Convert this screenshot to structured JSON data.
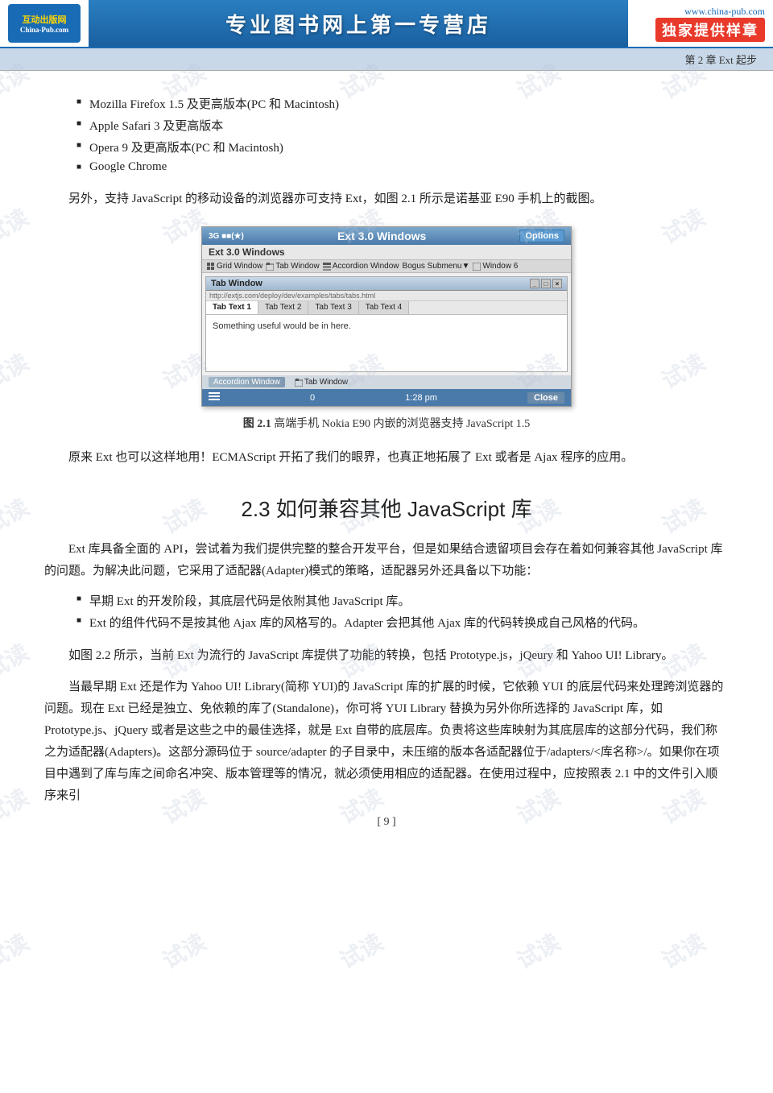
{
  "header": {
    "logo_top": "互动出版网",
    "logo_bottom": "China-Pub.com",
    "title": "专业图书网上第一专营店",
    "website": "www.china-pub.com",
    "exclusive": "独家提供样章"
  },
  "chapter_bar": {
    "text": "第 2 章   Ext 起步"
  },
  "bullet_items": [
    "Mozilla Firefox 1.5 及更高版本(PC 和 Macintosh)",
    "Apple Safari 3 及更高版本",
    "Opera 9 及更高版本(PC 和 Macintosh)",
    "Google Chrome"
  ],
  "para1": "另外，支持 JavaScript 的移动设备的浏览器亦可支持 Ext，如图 2.1 所示是诺基亚 E90 手机上的截图。",
  "figure": {
    "phone_header_left": "3G",
    "phone_title": "Ext 3.0 Windows",
    "phone_signal": "■■(★)",
    "phone_options": "Options",
    "phone_subheader": "Ext 3.0 Windows",
    "toolbar_items": [
      "Grid Window",
      "Tab Window",
      "Accordion Window",
      "Bogus Submenu▼",
      "Window 6"
    ],
    "window_title": "Tab Window",
    "window_url": "http://extjs.com/deploy/dev/examples/tabs/tabs.html",
    "tabs": [
      "Tab Text 1",
      "Tab Text 2",
      "Tab Text 3",
      "Tab Text 4"
    ],
    "active_tab": "Tab Text 1",
    "content": "Something useful would be in here.",
    "bottom_accordion": "Accordion Window",
    "bottom_tab": "Tab Window",
    "bottom_left_icon": "≡",
    "status_left": "0",
    "status_time": "1:28 pm",
    "status_close": "Close"
  },
  "figure_caption": {
    "number": "图 2.1",
    "text": "   高端手机 Nokia E90 内嵌的浏览器支持 JavaScript 1.5"
  },
  "para2": "原来 Ext 也可以这样地用！ECMAScript 开拓了我们的眼界，也真正地拓展了 Ext 或者是 Ajax 程序的应用。",
  "section_heading": "2.3   如何兼容其他 JavaScript 库",
  "para3": "Ext 库具备全面的 API，尝试着为我们提供完整的整合开发平台，但是如果结合遗留项目会存在着如何兼容其他 JavaScript 库的问题。为解决此问题，它采用了适配器(Adapter)模式的策略，适配器另外还具备以下功能：",
  "bullet2_items": [
    "早期 Ext 的开发阶段，其底层代码是依附其他 JavaScript 库。",
    "Ext 的组件代码不是按其他 Ajax 库的风格写的。Adapter 会把其他 Ajax 库的代码转换成自己风格的代码。"
  ],
  "para4": "如图 2.2 所示，当前 Ext 为流行的 JavaScript 库提供了功能的转换，包括 Prototype.js，jQeury 和 Yahoo UI! Library。",
  "para5": "当最早期 Ext 还是作为 Yahoo UI! Library(简称 YUI)的 JavaScript 库的扩展的时候，它依赖 YUI 的底层代码来处理跨浏览器的问题。现在 Ext 已经是独立、免依赖的库了(Standalone)，你可将 YUI Library 替换为另外你所选择的 JavaScript 库，如 Prototype.js、jQuery 或者是这些之中的最佳选择，就是 Ext 自带的底层库。负责将这些库映射为其底层库的这部分代码，我们称之为适配器(Adapters)。这部分源码位于 source/adapter 的子目录中，未压缩的版本各适配器位于/adapters/<库名称>/。如果你在项目中遇到了库与库之间命名冲突、版本管理等的情况，就必须使用相应的适配器。在使用过程中，应按照表 2.1 中的文件引入顺序来引",
  "footer": {
    "page": "[ 9 ]"
  },
  "watermark_text": "试读"
}
